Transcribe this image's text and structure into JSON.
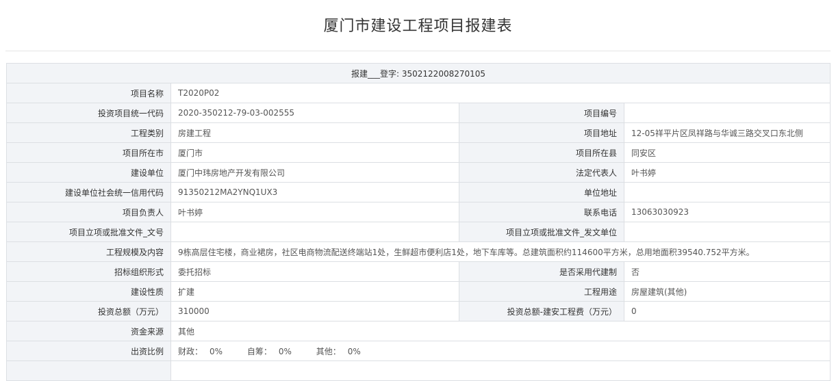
{
  "title": "厦门市建设工程项目报建表",
  "registration": {
    "label": "报建___登字:",
    "number": "3502122008270105"
  },
  "fields": {
    "project_name": {
      "label": "项目名称",
      "value": "T2020P02"
    },
    "investment_code": {
      "label": "投资项目统一代码",
      "value": "2020-350212-79-03-002555"
    },
    "project_number": {
      "label": "项目编号",
      "value": ""
    },
    "engineering_category": {
      "label": "工程类别",
      "value": "房建工程"
    },
    "project_address": {
      "label": "项目地址",
      "value": "12-05祥平片区凤祥路与华诚三路交叉口东北侧"
    },
    "city": {
      "label": "项目所在市",
      "value": "厦门市"
    },
    "county": {
      "label": "项目所在县",
      "value": "同安区"
    },
    "construction_unit": {
      "label": "建设单位",
      "value": "厦门中玮房地产开发有限公司"
    },
    "legal_rep": {
      "label": "法定代表人",
      "value": "叶书婷"
    },
    "credit_code": {
      "label": "建设单位社会统一信用代码",
      "value": "91350212MA2YNQ1UX3"
    },
    "unit_address": {
      "label": "单位地址",
      "value": ""
    },
    "project_leader": {
      "label": "项目负责人",
      "value": "叶书婷"
    },
    "phone": {
      "label": "联系电话",
      "value": "13063030923"
    },
    "approval_doc_no": {
      "label": "项目立项或批准文件_文号",
      "value": ""
    },
    "approval_issuer": {
      "label": "项目立项或批准文件_发文单位",
      "value": ""
    },
    "scale_content": {
      "label": "工程规模及内容",
      "value": "9栋高层住宅楼，商业裙房，社区电商物流配送终端站1处，生鲜超市便利店1处，地下车库等。总建筑面积约114600平方米，总用地面积39540.752平方米。"
    },
    "bidding_form": {
      "label": "招标组织形式",
      "value": "委托招标"
    },
    "agent_construction": {
      "label": "是否采用代建制",
      "value": "否"
    },
    "construction_nature": {
      "label": "建设性质",
      "value": "扩建"
    },
    "engineering_use": {
      "label": "工程用途",
      "value": "房屋建筑(其他)"
    },
    "total_investment": {
      "label": "投资总额（万元）",
      "value": "310000"
    },
    "installation_cost": {
      "label": "投资总额-建安工程费（万元）",
      "value": "0"
    },
    "fund_source": {
      "label": "资金来源",
      "value": "其他"
    },
    "funding_ratio": {
      "label": "出资比例",
      "items": [
        {
          "name": "财政：",
          "value": "0%"
        },
        {
          "name": "自筹：",
          "value": "0%"
        },
        {
          "name": "其他：",
          "value": "0%"
        }
      ]
    }
  }
}
